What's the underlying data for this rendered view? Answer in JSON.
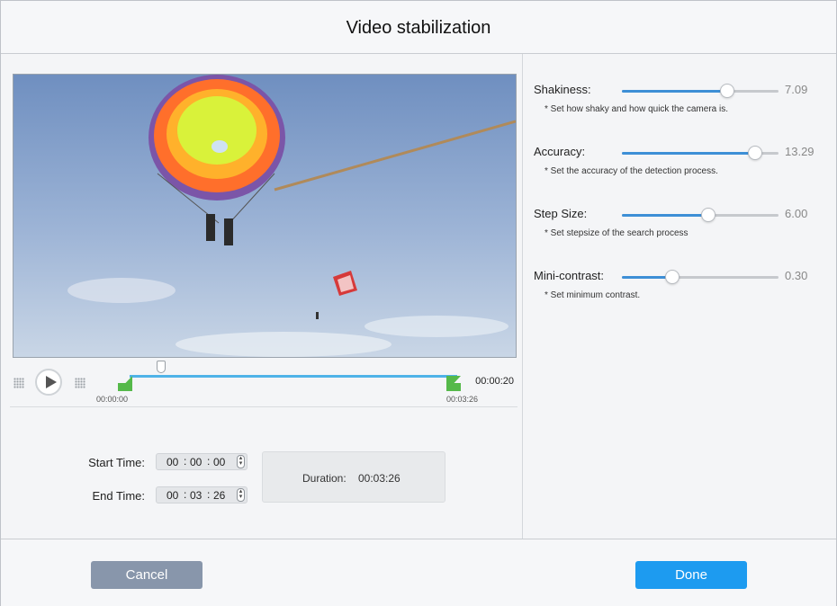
{
  "window": {
    "title": "Video stabilization"
  },
  "timeline": {
    "start_label": "00:00:00",
    "end_label": "00:03:26",
    "current_time": "00:00:20"
  },
  "trim": {
    "start_label": "Start Time:",
    "start": {
      "h": "00",
      "m": "00",
      "s": "00"
    },
    "end_label": "End Time:",
    "end": {
      "h": "00",
      "m": "03",
      "s": "26"
    },
    "duration_label": "Duration:",
    "duration_value": "00:03:26"
  },
  "params": [
    {
      "name": "Shakiness:",
      "value": "7.09",
      "level": 0.67,
      "hint": "* Set how shaky and how quick the camera is."
    },
    {
      "name": "Accuracy:",
      "value": "13.29",
      "level": 0.85,
      "hint": "* Set the accuracy of the detection process."
    },
    {
      "name": "Step Size:",
      "value": "6.00",
      "level": 0.55,
      "hint": "* Set stepsize of the search process"
    },
    {
      "name": "Mini-contrast:",
      "value": "0.30",
      "level": 0.32,
      "hint": "* Set minimum contrast."
    }
  ],
  "footer": {
    "cancel_label": "Cancel",
    "done_label": "Done"
  },
  "colors": {
    "accent": "#1d9bf0",
    "cancel": "#8896ab",
    "slider_fill": "#3d8fd6",
    "trim_marker": "#55b94a",
    "track": "#4fb3e8"
  }
}
